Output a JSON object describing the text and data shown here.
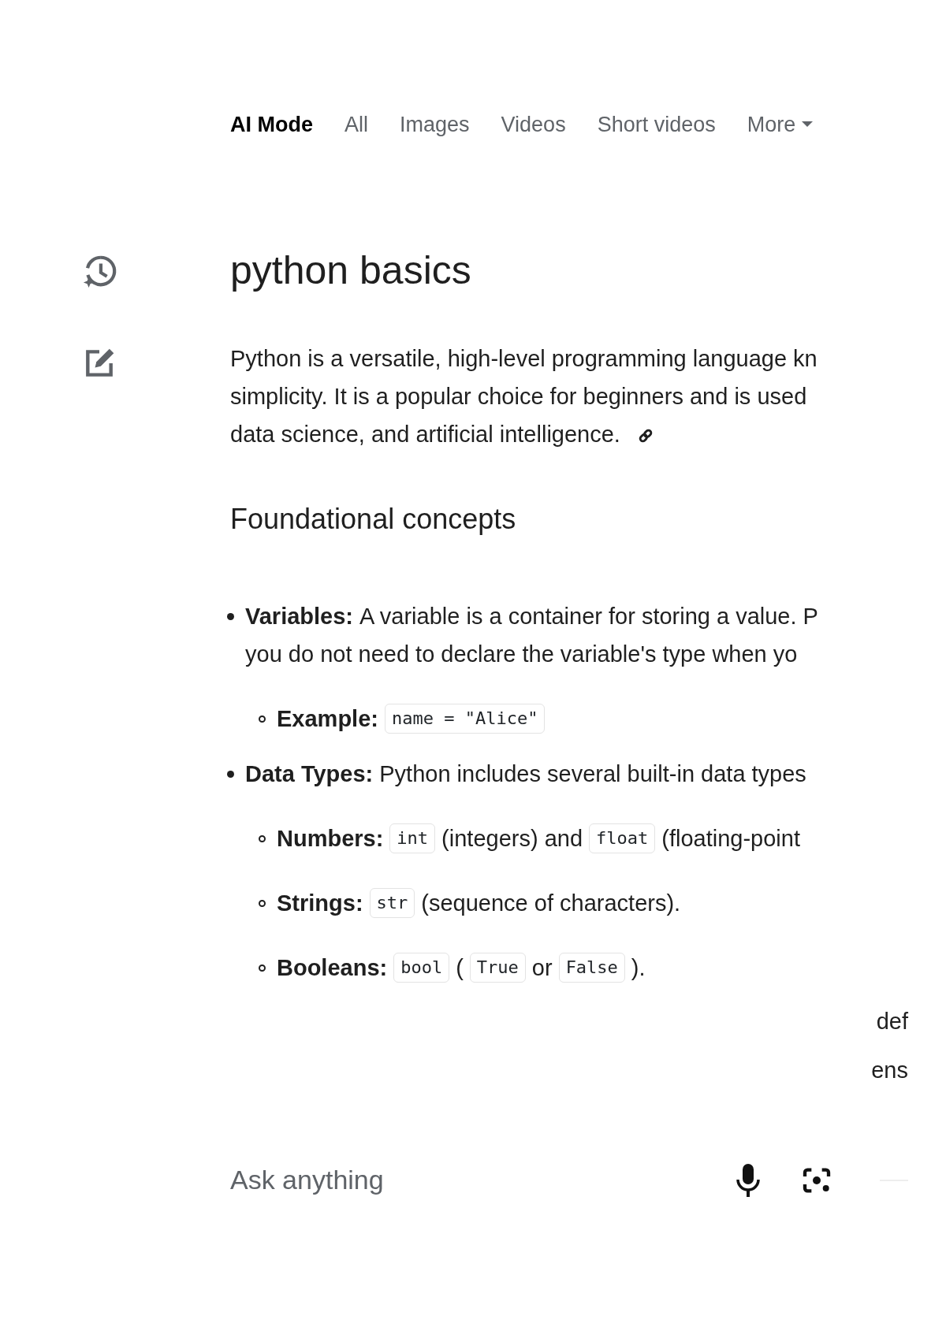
{
  "nav": {
    "tabs": [
      {
        "label": "AI Mode",
        "selected": true,
        "dropdown": false
      },
      {
        "label": "All",
        "selected": false,
        "dropdown": false
      },
      {
        "label": "Images",
        "selected": false,
        "dropdown": false
      },
      {
        "label": "Videos",
        "selected": false,
        "dropdown": false
      },
      {
        "label": "Short videos",
        "selected": false,
        "dropdown": false
      },
      {
        "label": "More",
        "selected": false,
        "dropdown": true
      }
    ]
  },
  "title": "python basics",
  "intro": {
    "lines": [
      "Python is a versatile, high-level programming language kn",
      "simplicity. It is a popular choice for beginners and is used",
      "data science, and artificial intelligence."
    ]
  },
  "section_heading": "Foundational concepts",
  "bullets": [
    {
      "label": "Variables:",
      "lines": [
        [
          {
            "kind": "text",
            "text": "A variable is a container for storing a value. P"
          }
        ],
        [
          {
            "kind": "text",
            "text": "you do not need to declare the variable's type when yo"
          }
        ]
      ],
      "children": [
        {
          "label": "Example:",
          "lines": [
            [
              {
                "kind": "code",
                "text": "name = \"Alice\""
              }
            ]
          ]
        }
      ]
    },
    {
      "label": "Data Types:",
      "lines": [
        [
          {
            "kind": "text",
            "text": "Python includes several built-in data types"
          }
        ]
      ],
      "children": [
        {
          "label": "Numbers:",
          "lines": [
            [
              {
                "kind": "code",
                "text": "int"
              },
              {
                "kind": "text",
                "text": "(integers) and"
              },
              {
                "kind": "code",
                "text": "float"
              },
              {
                "kind": "text",
                "text": "(floating-point"
              }
            ]
          ]
        },
        {
          "label": "Strings:",
          "lines": [
            [
              {
                "kind": "code",
                "text": "str"
              },
              {
                "kind": "text",
                "text": "(sequence of characters)."
              }
            ]
          ]
        },
        {
          "label": "Booleans:",
          "lines": [
            [
              {
                "kind": "code",
                "text": "bool"
              },
              {
                "kind": "text",
                "text": "("
              },
              {
                "kind": "code",
                "text": "True"
              },
              {
                "kind": "text",
                "text": "or"
              },
              {
                "kind": "code",
                "text": "False"
              },
              {
                "kind": "text",
                "text": ")."
              }
            ]
          ]
        }
      ]
    }
  ],
  "fragments": [
    "def",
    "ens"
  ],
  "ask": {
    "placeholder": "Ask anything"
  }
}
